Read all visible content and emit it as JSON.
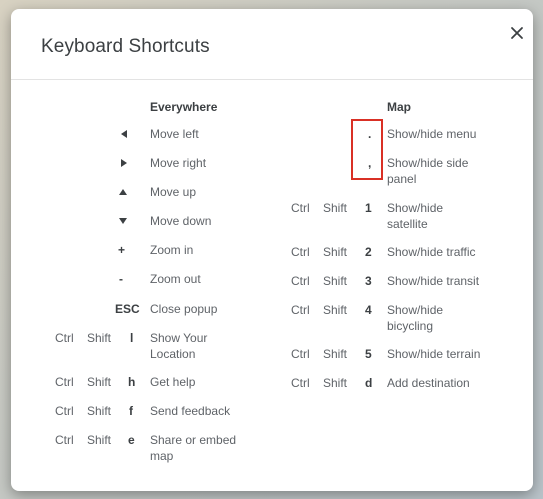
{
  "dialog": {
    "title": "Keyboard Shortcuts",
    "close_label": "close"
  },
  "everywhere": {
    "heading": "Everywhere",
    "rows": [
      {
        "keys": [],
        "icon": "arrow-left-icon",
        "label": "Move left"
      },
      {
        "keys": [],
        "icon": "arrow-right-icon",
        "label": "Move right"
      },
      {
        "keys": [],
        "icon": "arrow-up-icon",
        "label": "Move up"
      },
      {
        "keys": [],
        "icon": "arrow-down-icon",
        "label": "Move down"
      },
      {
        "keys": [
          "+"
        ],
        "label": "Zoom in"
      },
      {
        "keys": [
          "-"
        ],
        "label": "Zoom out"
      },
      {
        "keys": [
          "ESC"
        ],
        "label": "Close popup"
      },
      {
        "keys": [
          "Ctrl",
          "Shift",
          "l"
        ],
        "label": "Show Your Location"
      },
      {
        "keys": [
          "Ctrl",
          "Shift",
          "h"
        ],
        "label": "Get help"
      },
      {
        "keys": [
          "Ctrl",
          "Shift",
          "f"
        ],
        "label": "Send feedback"
      },
      {
        "keys": [
          "Ctrl",
          "Shift",
          "e"
        ],
        "label": "Share or embed map"
      }
    ]
  },
  "map": {
    "heading": "Map",
    "rows": [
      {
        "keys": [
          "."
        ],
        "label": "Show/hide menu"
      },
      {
        "keys": [
          ","
        ],
        "label": "Show/hide side panel"
      },
      {
        "keys": [
          "Ctrl",
          "Shift",
          "1"
        ],
        "label": "Show/hide satellite"
      },
      {
        "keys": [
          "Ctrl",
          "Shift",
          "2"
        ],
        "label": "Show/hide traffic"
      },
      {
        "keys": [
          "Ctrl",
          "Shift",
          "3"
        ],
        "label": "Show/hide transit"
      },
      {
        "keys": [
          "Ctrl",
          "Shift",
          "4"
        ],
        "label": "Show/hide bicycling"
      },
      {
        "keys": [
          "Ctrl",
          "Shift",
          "5"
        ],
        "label": "Show/hide terrain"
      },
      {
        "keys": [
          "Ctrl",
          "Shift",
          "d"
        ],
        "label": "Add destination"
      }
    ]
  },
  "colors": {
    "highlight": "#d93025",
    "text": "#5f6368",
    "heading": "#3c4043"
  }
}
